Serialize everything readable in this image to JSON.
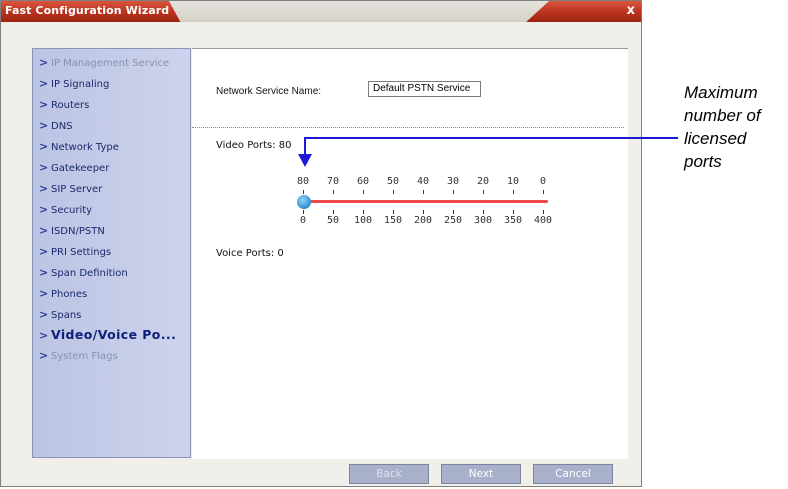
{
  "window": {
    "title": "Fast Configuration Wizard",
    "close_glyph": "x"
  },
  "sidebar": {
    "items": [
      {
        "label": "IP Management Service",
        "state": "disabled"
      },
      {
        "label": "IP Signaling",
        "state": "normal"
      },
      {
        "label": "Routers",
        "state": "normal"
      },
      {
        "label": "DNS",
        "state": "normal"
      },
      {
        "label": "Network Type",
        "state": "normal"
      },
      {
        "label": "Gatekeeper",
        "state": "normal"
      },
      {
        "label": "SIP Server",
        "state": "normal"
      },
      {
        "label": "Security",
        "state": "normal"
      },
      {
        "label": "ISDN/PSTN",
        "state": "normal"
      },
      {
        "label": "PRI Settings",
        "state": "normal"
      },
      {
        "label": "Span Definition",
        "state": "normal"
      },
      {
        "label": "Phones",
        "state": "normal"
      },
      {
        "label": "Spans",
        "state": "normal"
      },
      {
        "label": "Video/Voice Po...",
        "state": "active"
      },
      {
        "label": "System Flags",
        "state": "disabled"
      }
    ],
    "arrow_glyph": ">"
  },
  "content": {
    "network_service_label": "Network Service Name:",
    "network_service_value": "Default PSTN Service",
    "video_ports_label": "Video Ports: 80",
    "voice_ports_label": "Voice Ports: 0",
    "slider": {
      "top_ticks": [
        "80",
        "70",
        "60",
        "50",
        "40",
        "30",
        "20",
        "10",
        "0"
      ],
      "bottom_ticks": [
        "0",
        "50",
        "100",
        "150",
        "200",
        "250",
        "300",
        "350",
        "400"
      ],
      "value": 0,
      "min": 0,
      "max": 400
    }
  },
  "buttons": {
    "back": "Back",
    "next": "Next",
    "cancel": "Cancel"
  },
  "annotation": {
    "lines": [
      "Maximum",
      "number of",
      "licensed",
      "ports"
    ]
  },
  "colors": {
    "title_bar": "#b9321e",
    "sidebar": "#c5cce9",
    "slider_track": "#ef4949",
    "annotation": "#1b1bd6",
    "button": "#a9b0cc"
  }
}
